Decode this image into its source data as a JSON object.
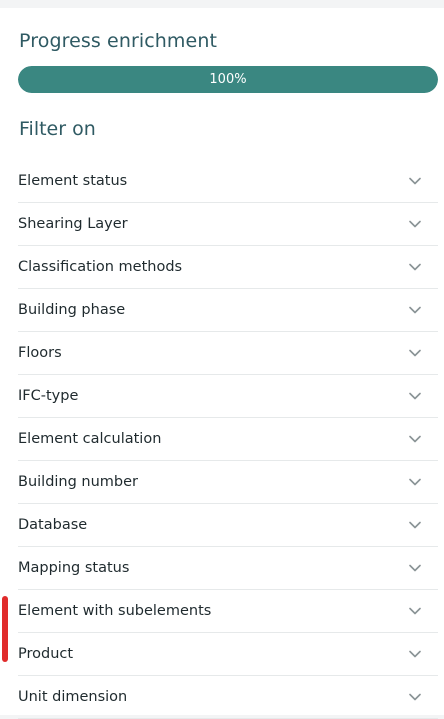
{
  "progress": {
    "title": "Progress enrichment",
    "value_label": "100%",
    "value_fraction": 1.0
  },
  "filter": {
    "title": "Filter on",
    "items": [
      {
        "label": "Element status",
        "icon": "chevron-down-icon"
      },
      {
        "label": "Shearing Layer",
        "icon": "chevron-down-icon"
      },
      {
        "label": "Classification methods",
        "icon": "chevron-down-icon"
      },
      {
        "label": "Building phase",
        "icon": "chevron-down-icon"
      },
      {
        "label": "Floors",
        "icon": "chevron-down-icon"
      },
      {
        "label": "IFC-type",
        "icon": "chevron-down-icon"
      },
      {
        "label": "Element calculation",
        "icon": "chevron-down-icon"
      },
      {
        "label": "Building number",
        "icon": "chevron-down-icon"
      },
      {
        "label": "Database",
        "icon": "chevron-down-icon"
      },
      {
        "label": "Mapping status",
        "icon": "chevron-down-icon"
      },
      {
        "label": "Element with subelements",
        "icon": "chevron-down-icon"
      },
      {
        "label": "Product",
        "icon": "chevron-down-icon"
      },
      {
        "label": "Unit dimension",
        "icon": "chevron-down-icon"
      }
    ]
  },
  "colors": {
    "accent": "#3a8781",
    "heading": "#2f5a63",
    "highlight_marker": "#e02b2b"
  }
}
